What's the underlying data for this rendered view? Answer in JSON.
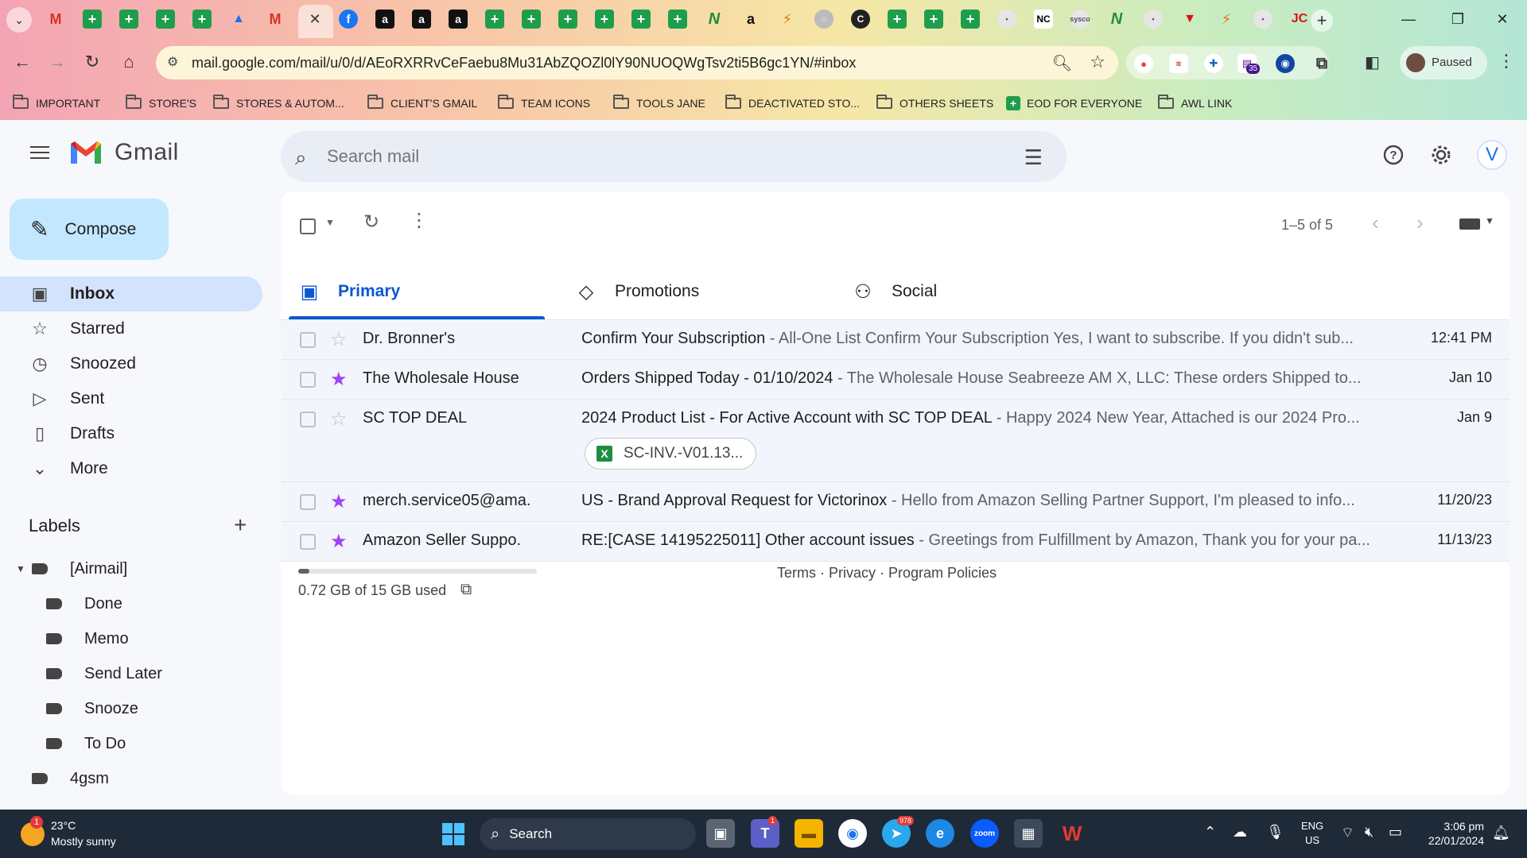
{
  "browser": {
    "url": "mail.google.com/mail/u/0/d/AEoRXRRvCeFaebu8Mu31AbZQOZl0lY90NUOQWgTsv2ti5B6gc1YN/#inbox",
    "profile_label": "Paused",
    "extension_badge": "35",
    "tab_icons": [
      "gmail-icon",
      "sheets-icon",
      "sheets-icon",
      "sheets-icon",
      "sheets-icon",
      "drive-icon",
      "gmail-icon",
      "close-icon",
      "facebook-icon",
      "amazon-icon",
      "amazon-icon",
      "amazon-icon",
      "sheets-icon",
      "sheets-icon",
      "sheets-icon",
      "sheets-icon",
      "sheets-icon",
      "sheets-icon",
      "green-n-icon",
      "amazon-a-icon",
      "zap-icon",
      "grey-circle-icon",
      "dark-circle-icon",
      "sheets-icon",
      "sheets-icon",
      "sheets-icon",
      "misc-icon",
      "nc-icon",
      "sysco-icon",
      "green-n-icon",
      "misc-icon",
      "red-v-icon",
      "zap-icon",
      "misc-icon",
      "jc-icon"
    ],
    "bookmarks": [
      {
        "label": "IMPORTANT",
        "icon": "folder-icon"
      },
      {
        "label": "STORE'S",
        "icon": "folder-icon"
      },
      {
        "label": "STORES & AUTOM...",
        "icon": "folder-icon"
      },
      {
        "label": "CLIENT'S GMAIL",
        "icon": "folder-icon"
      },
      {
        "label": "TEAM ICONS",
        "icon": "folder-icon"
      },
      {
        "label": "TOOLS JANE",
        "icon": "folder-icon"
      },
      {
        "label": "DEACTIVATED STO...",
        "icon": "folder-icon"
      },
      {
        "label": "OTHERS SHEETS",
        "icon": "folder-icon"
      },
      {
        "label": "EOD FOR EVERYONE",
        "icon": "sheets-icon"
      },
      {
        "label": "AWL LINK",
        "icon": "folder-icon"
      }
    ]
  },
  "gmail": {
    "wordmark": "Gmail",
    "search_placeholder": "Search mail",
    "avatar_letter": "V",
    "compose_label": "Compose",
    "nav": [
      {
        "label": "Inbox",
        "icon": "inbox-icon",
        "active": true
      },
      {
        "label": "Starred",
        "icon": "star-icon",
        "active": false
      },
      {
        "label": "Snoozed",
        "icon": "clock-icon",
        "active": false
      },
      {
        "label": "Sent",
        "icon": "send-icon",
        "active": false
      },
      {
        "label": "Drafts",
        "icon": "draft-icon",
        "active": false
      },
      {
        "label": "More",
        "icon": "chevron-down-icon",
        "active": false
      }
    ],
    "labels_title": "Labels",
    "labels": [
      {
        "label": "[Airmail]",
        "level": 0,
        "expanded": true
      },
      {
        "label": "Done",
        "level": 1
      },
      {
        "label": "Memo",
        "level": 1
      },
      {
        "label": "Send Later",
        "level": 1
      },
      {
        "label": "Snooze",
        "level": 1
      },
      {
        "label": "To Do",
        "level": 1
      },
      {
        "label": "4gsm",
        "level": 0
      }
    ],
    "pager": "1–5 of 5",
    "tabs": [
      {
        "label": "Primary",
        "icon": "inbox-icon",
        "active": true
      },
      {
        "label": "Promotions",
        "icon": "tag-icon",
        "active": false
      },
      {
        "label": "Social",
        "icon": "people-icon",
        "active": false
      }
    ],
    "emails": [
      {
        "sender": "Dr. Bronner's",
        "starred": false,
        "subject": "Confirm Your Subscription",
        "snippet": " - All-One List Confirm Your Subscription Yes, I want to subscribe. If you didn't sub...",
        "date": "12:41 PM",
        "attachment": ""
      },
      {
        "sender": "The Wholesale House",
        "starred": true,
        "subject": "Orders Shipped Today - 01/10/2024",
        "snippet": " - The Wholesale House Seabreeze AM X, LLC: These orders Shipped to...",
        "date": "Jan 10",
        "attachment": ""
      },
      {
        "sender": "SC TOP DEAL",
        "starred": false,
        "subject": "2024 Product List - For Active Account with SC TOP DEAL",
        "snippet": " - Happy 2024 New Year, Attached is our 2024 Pro...",
        "date": "Jan 9",
        "attachment": "SC-INV.-V01.13..."
      },
      {
        "sender": "merch.service05@ama.",
        "starred": true,
        "subject": "US - Brand Approval Request for Victorinox",
        "snippet": " - Hello from Amazon Selling Partner Support, I'm pleased to info...",
        "date": "11/20/23",
        "attachment": ""
      },
      {
        "sender": "Amazon Seller Suppo.",
        "starred": true,
        "subject": "RE:[CASE 14195225011] Other account issues",
        "snippet": " - Greetings from Fulfillment by Amazon, Thank you for your pa...",
        "date": "11/13/23",
        "attachment": ""
      }
    ],
    "storage_text": "0.72 GB of 15 GB used",
    "storage_fraction": 0.048,
    "footer_links": "Terms · Privacy · Program Policies",
    "accent_color": "#0b57d0",
    "star_color": "#a142f4"
  },
  "taskbar": {
    "weather_temp": "23°C",
    "weather_condition": "Mostly sunny",
    "weather_badge": "1",
    "search_label": "Search",
    "telegram_badge": "978",
    "teams_badge": "1",
    "lang_line1": "ENG",
    "lang_line2": "US",
    "time": "3:06 pm",
    "date": "22/01/2024"
  }
}
